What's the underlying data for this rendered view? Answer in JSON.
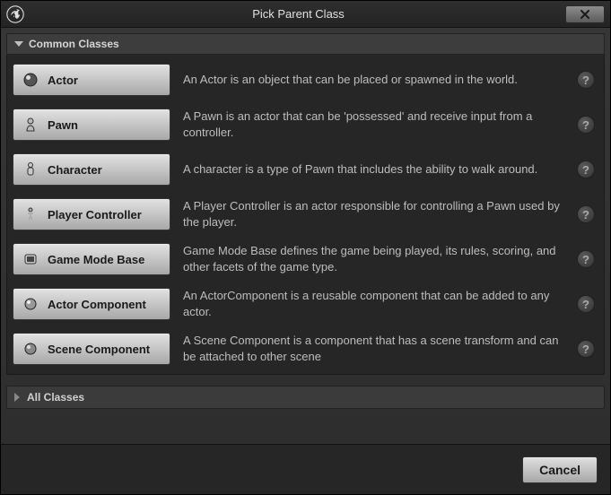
{
  "title": "Pick Parent Class",
  "sections": {
    "common": {
      "label": "Common Classes",
      "expanded": true
    },
    "all": {
      "label": "All Classes",
      "expanded": false
    }
  },
  "classes": [
    {
      "id": "actor",
      "label": "Actor",
      "desc": "An Actor is an object that can be placed or spawned in the world."
    },
    {
      "id": "pawn",
      "label": "Pawn",
      "desc": "A Pawn is an actor that can be 'possessed' and receive input from a controller."
    },
    {
      "id": "character",
      "label": "Character",
      "desc": "A character is a type of Pawn that includes the ability to walk around."
    },
    {
      "id": "player-controller",
      "label": "Player Controller",
      "desc": "A Player Controller is an actor responsible for controlling a Pawn used by the player."
    },
    {
      "id": "game-mode-base",
      "label": "Game Mode Base",
      "desc": "Game Mode Base defines the game being played, its rules, scoring, and other facets of the game type."
    },
    {
      "id": "actor-component",
      "label": "Actor Component",
      "desc": "An ActorComponent is a reusable component that can be added to any actor."
    },
    {
      "id": "scene-component",
      "label": "Scene Component",
      "desc": "A Scene Component is a component that has a scene transform and can be attached to other scene"
    }
  ],
  "help_glyph": "?",
  "footer": {
    "cancel": "Cancel"
  }
}
